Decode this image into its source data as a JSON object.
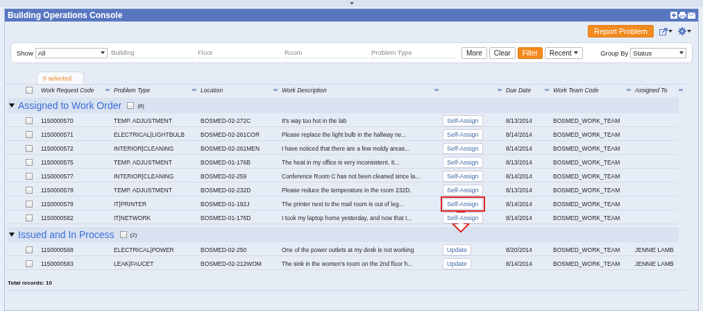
{
  "window": {
    "title": "Building Operations Console"
  },
  "toolbar": {
    "report_button": "Report Problem"
  },
  "filters": {
    "show_label": "Show",
    "show_value": "All",
    "fields": [
      {
        "placeholder": "Building"
      },
      {
        "placeholder": "Floor"
      },
      {
        "placeholder": "Room"
      },
      {
        "placeholder": "Problem Type"
      }
    ],
    "buttons": [
      {
        "label": "More",
        "kind": "plain"
      },
      {
        "label": "Clear",
        "kind": "plain"
      },
      {
        "label": "Filter",
        "kind": "primary"
      },
      {
        "label": "Recent",
        "kind": "menu"
      }
    ],
    "group_by_label": "Group By",
    "group_by_value": "Status"
  },
  "selection_tab": "0 selected",
  "table": {
    "all_checked": false,
    "columns": [
      "Work Request Code",
      "Problem Type",
      "Location",
      "Work Description",
      null,
      "Due Date",
      "Work Team Code",
      "Assigned To"
    ],
    "groups": [
      {
        "title": "Assigned to Work Order",
        "count": "(8)",
        "expanded": true,
        "checked": false,
        "rows": [
          {
            "checked": false,
            "code": "1150000570",
            "type": "TEMP. ADJUSTMENT",
            "location": "BOSMED-02-272C",
            "description": "It's way too hot in the lab",
            "action": "Self-Assign",
            "highlighted": false,
            "due": "8/13/2014",
            "team": "BOSMED_WORK_TEAM"
          },
          {
            "checked": false,
            "code": "1150000571",
            "type": "ELECTRICAL|LIGHTBULB",
            "location": "BOSMED-02-261COR",
            "description": "Please replace the light bulb in the hallway ne...",
            "action": "Self-Assign",
            "highlighted": false,
            "due": "8/14/2014",
            "team": "BOSMED_WORK_TEAM"
          },
          {
            "checked": false,
            "code": "1150000572",
            "type": "INTERIOR|CLEANING",
            "location": "BOSMED-02-261MEN",
            "description": "I have noticed that there are a few moldy areas...",
            "action": "Self-Assign",
            "highlighted": false,
            "due": "8/14/2014",
            "team": "BOSMED_WORK_TEAM"
          },
          {
            "checked": false,
            "code": "1150000575",
            "type": "TEMP. ADJUSTMENT",
            "location": "BOSMED-01-176B",
            "description": "The heat in my office is very inconsistent. It...",
            "action": "Self-Assign",
            "highlighted": false,
            "due": "8/13/2014",
            "team": "BOSMED_WORK_TEAM"
          },
          {
            "checked": false,
            "code": "1150000577",
            "type": "INTERIOR|CLEANING",
            "location": "BOSMED-02-259",
            "description": "Conference Room C has not been cleaned since la...",
            "action": "Self-Assign",
            "highlighted": false,
            "due": "8/14/2014",
            "team": "BOSMED_WORK_TEAM"
          },
          {
            "checked": false,
            "code": "1150000578",
            "type": "TEMP. ADJUSTMENT",
            "location": "BOSMED-02-232D",
            "description": "Please reduce the temperature in the room 232D.",
            "action": "Self-Assign",
            "highlighted": false,
            "due": "8/13/2014",
            "team": "BOSMED_WORK_TEAM"
          },
          {
            "checked": false,
            "code": "1150000579",
            "type": "IT|PRINTER",
            "location": "BOSMED-01-192J",
            "description": "The printer next to the mail room is out of leg...",
            "action": "Self-Assign",
            "highlighted": true,
            "due": "8/14/2014",
            "team": "BOSMED_WORK_TEAM"
          },
          {
            "checked": false,
            "code": "1150000582",
            "type": "IT|NETWORK",
            "location": "BOSMED-01-176D",
            "description": "I took my laptop home yesterday, and now that I...",
            "action": "Self-Assign",
            "highlighted": false,
            "due": "8/14/2014",
            "team": "BOSMED_WORK_TEAM"
          }
        ]
      },
      {
        "title": "Issued and In Process",
        "count": "(2)",
        "expanded": true,
        "checked": false,
        "rows": [
          {
            "checked": false,
            "code": "1150000568",
            "type": "ELECTRICAL|POWER",
            "location": "BOSMED-02-250",
            "description": "One of the power outlets at my desk is not working",
            "action": "Update",
            "highlighted": false,
            "due": "8/20/2014",
            "team": "BOSMED_WORK_TEAM",
            "assigned": "JENNIE LAMB"
          },
          {
            "checked": false,
            "code": "1150000583",
            "type": "LEAK|FAUCET",
            "location": "BOSMED-02-212WOM",
            "description": "The sink in the women's room on the 2nd floor h...",
            "action": "Update",
            "highlighted": false,
            "due": "8/14/2014",
            "team": "BOSMED_WORK_TEAM",
            "assigned": "JENNIE LAMB"
          }
        ]
      }
    ]
  },
  "total": "Total records: 10"
}
